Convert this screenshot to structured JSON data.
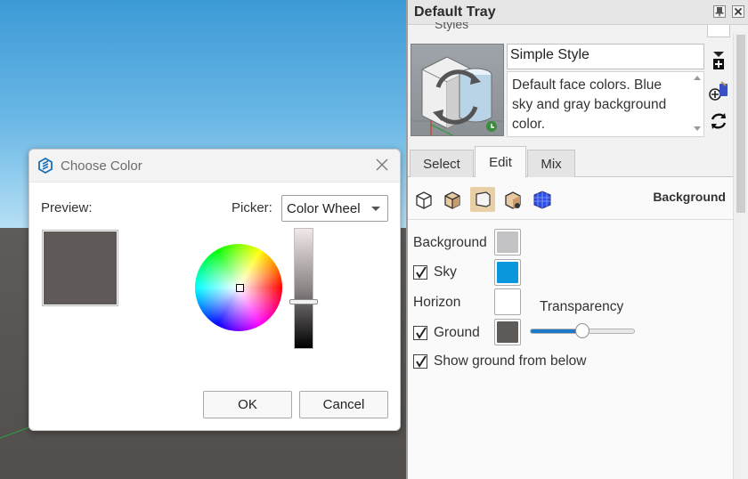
{
  "viewport": {
    "sky_color": "#4aa3dc",
    "ground_color": "#5b5856"
  },
  "color_dialog": {
    "title": "Choose Color",
    "icon": "sketchup-logo-icon",
    "preview_label": "Preview:",
    "preview_color": "#5f5a57",
    "picker_label": "Picker:",
    "picker_value": "Color Wheel",
    "value_level": 0.6,
    "ok_label": "OK",
    "cancel_label": "Cancel"
  },
  "tray": {
    "title": "Default Tray",
    "section": "Styles",
    "style_name": "Simple Style",
    "style_description": "Default face colors. Blue sky and gray background color.",
    "tabs": [
      {
        "label": "Select"
      },
      {
        "label": "Edit",
        "active": true
      },
      {
        "label": "Mix"
      }
    ],
    "edit_section_title": "Background",
    "background": {
      "background_label": "Background",
      "background_color": "#c3c3c5",
      "sky_label": "Sky",
      "sky_checked": true,
      "sky_color": "#0b97db",
      "horizon_label": "Horizon",
      "horizon_color": "#ffffff",
      "transparency_label": "Transparency",
      "transparency_value": 0.5,
      "ground_label": "Ground",
      "ground_checked": true,
      "ground_color": "#5e5a58",
      "show_ground_label": "Show ground from below",
      "show_ground_checked": true
    }
  }
}
